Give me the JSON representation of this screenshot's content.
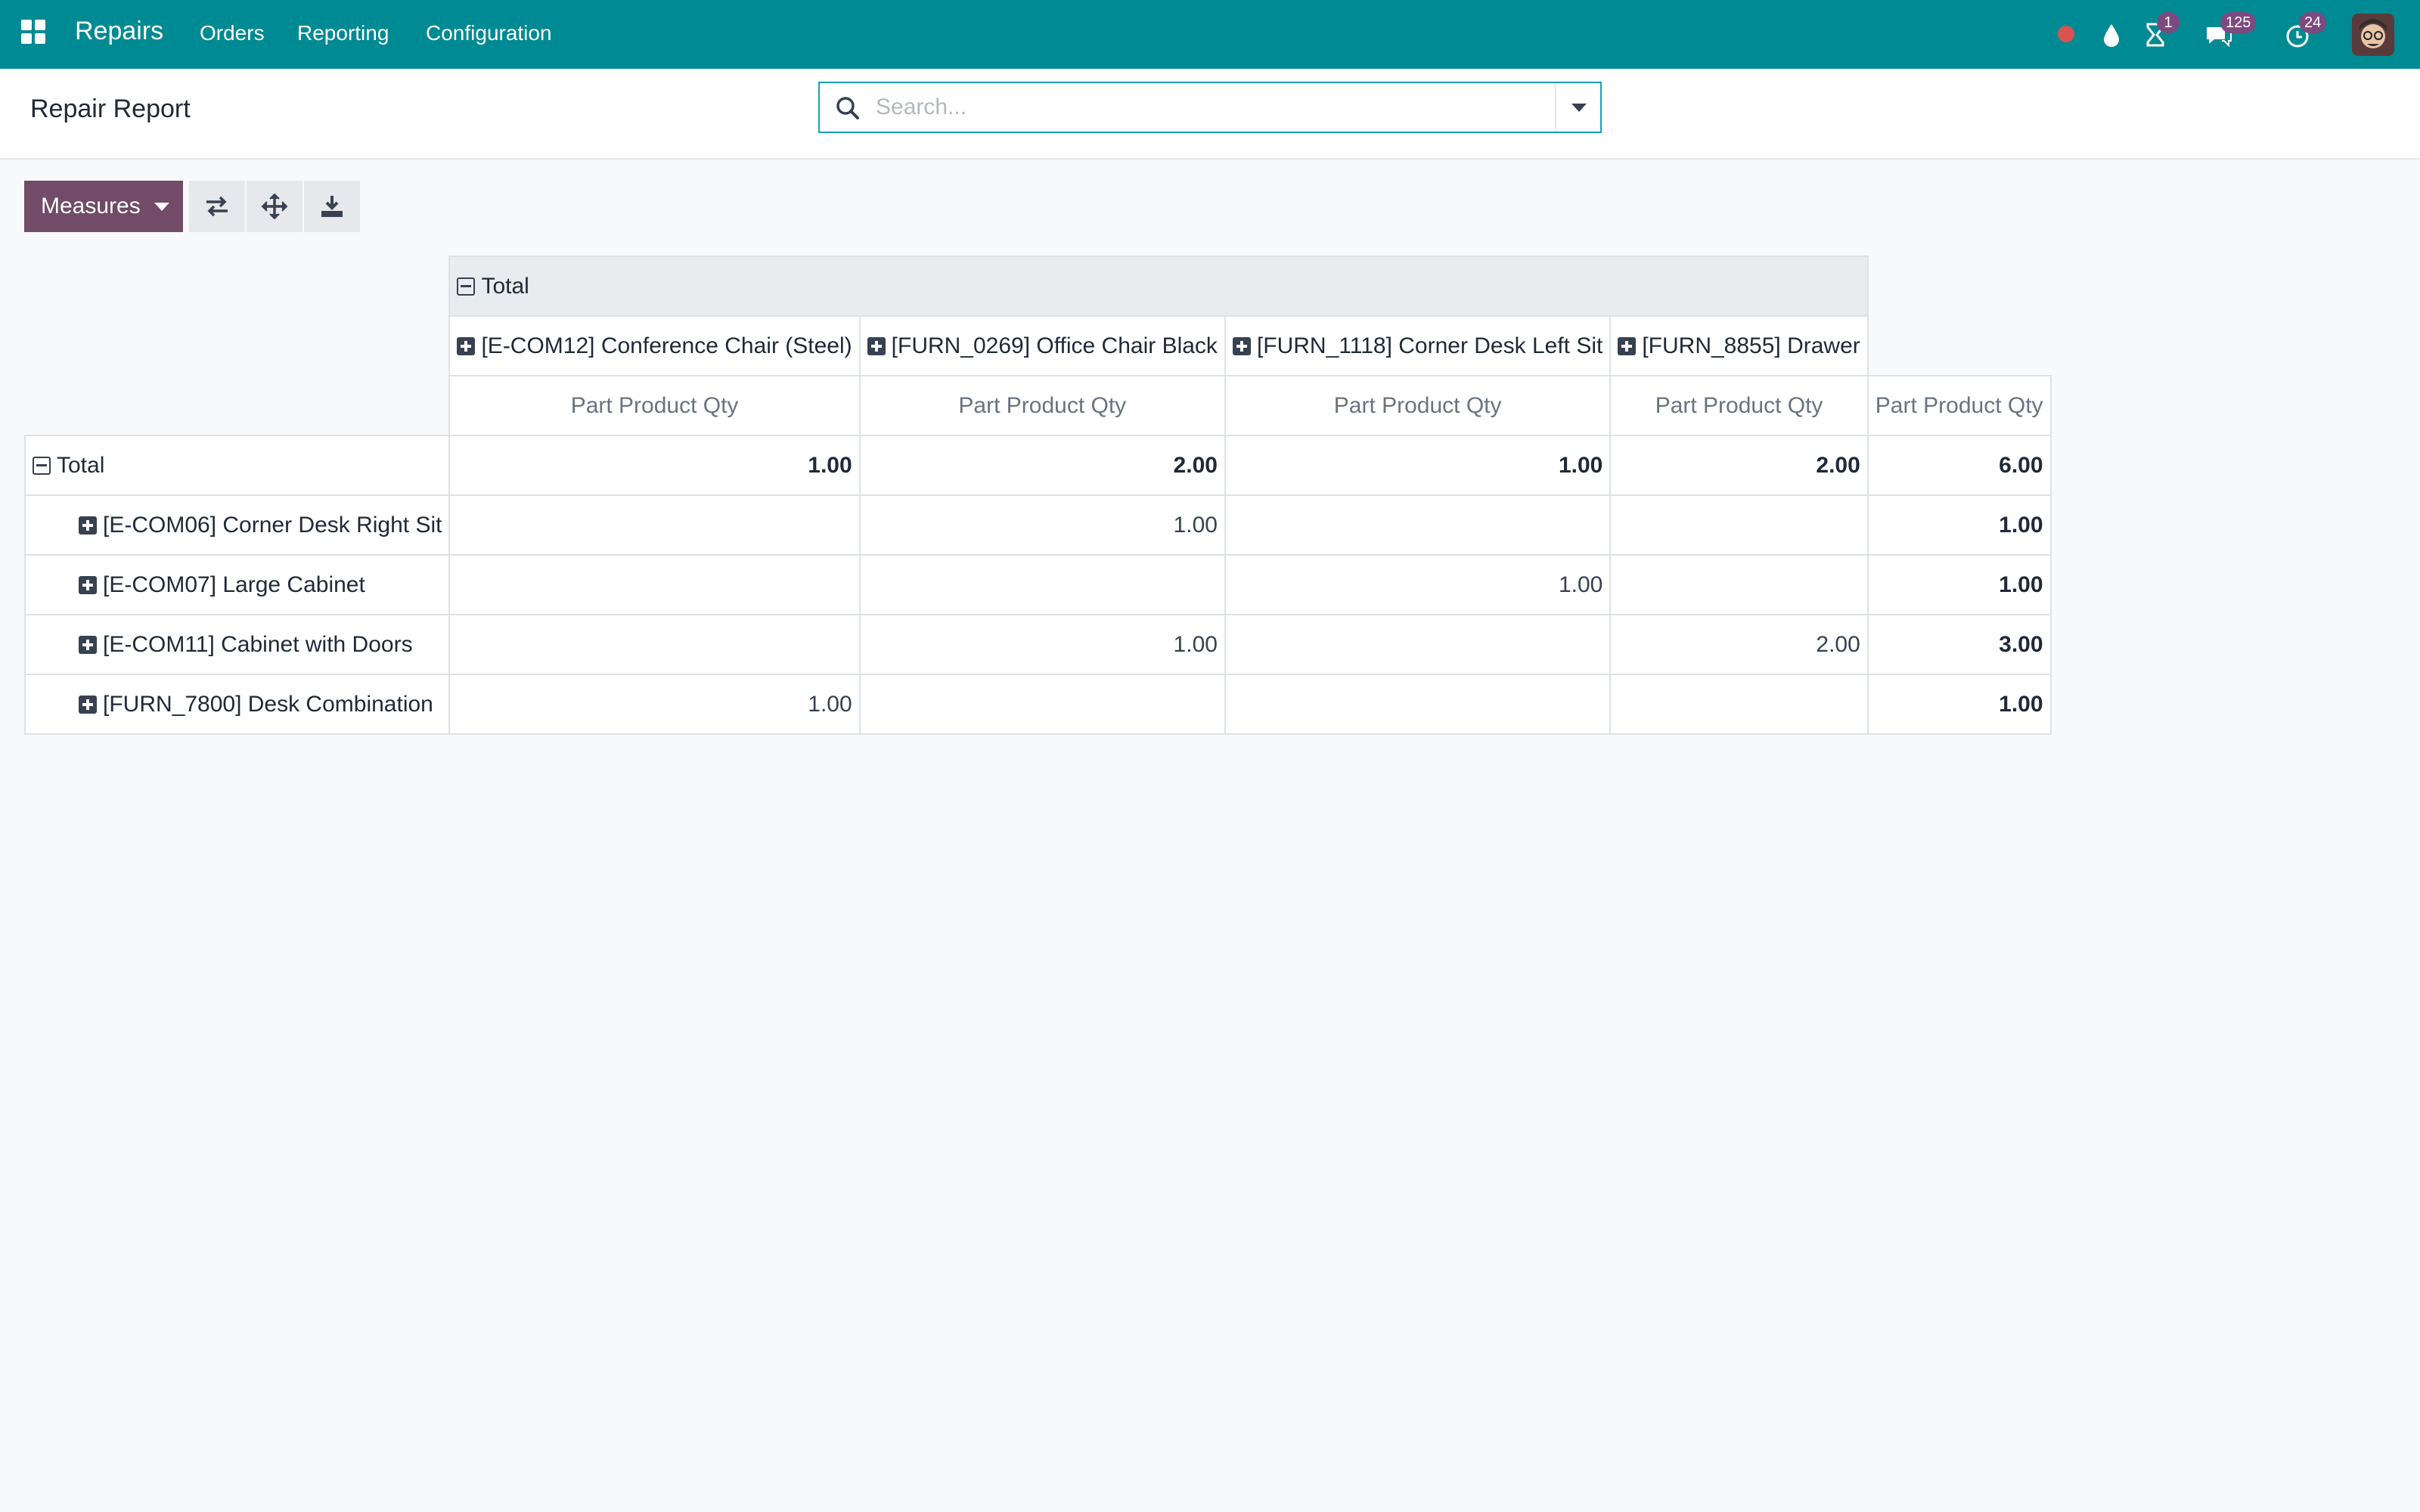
{
  "navbar": {
    "app_name": "Repairs",
    "menu": [
      "Orders",
      "Reporting",
      "Configuration"
    ],
    "badges": {
      "activities": "1",
      "messages": "125",
      "timer": "24"
    },
    "colors": {
      "bar": "#008a93",
      "badge": "#7c4a7e",
      "recording": "#d9534f"
    }
  },
  "control_panel": {
    "title": "Repair Report",
    "search_placeholder": "Search..."
  },
  "toolbar": {
    "measures_label": "Measures",
    "accent": "#714b67"
  },
  "pivot": {
    "header_total": "Total",
    "columns": [
      "[E-COM12] Conference Chair (Steel)",
      "[FURN_0269] Office Chair Black",
      "[FURN_1118] Corner Desk Left Sit",
      "[FURN_8855] Drawer"
    ],
    "measure": "Part Product Qty",
    "total_row": {
      "label": "Total",
      "values": [
        "1.00",
        "2.00",
        "1.00",
        "2.00",
        "6.00"
      ]
    },
    "rows": [
      {
        "label": "[E-COM06] Corner Desk Right Sit",
        "values": [
          "",
          "1.00",
          "",
          "",
          "1.00"
        ]
      },
      {
        "label": "[E-COM07] Large Cabinet",
        "values": [
          "",
          "",
          "1.00",
          "",
          "1.00"
        ]
      },
      {
        "label": "[E-COM11] Cabinet with Doors",
        "values": [
          "",
          "1.00",
          "",
          "2.00",
          "3.00"
        ]
      },
      {
        "label": "[FURN_7800] Desk Combination",
        "values": [
          "1.00",
          "",
          "",
          "",
          "1.00"
        ]
      }
    ]
  }
}
